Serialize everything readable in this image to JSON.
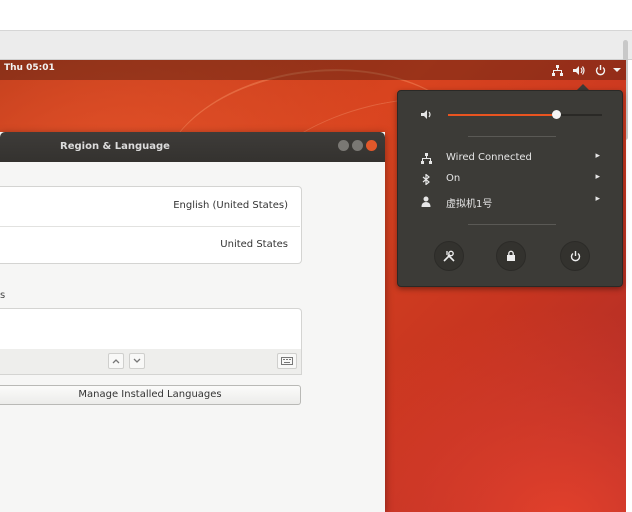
{
  "topbar": {
    "clock": "Thu 05:01"
  },
  "window": {
    "title": "Region & Language",
    "language_value": "English (United States)",
    "formats_value": "United States",
    "input_sources_label": "s",
    "manage_button": "Manage Installed Languages"
  },
  "system_menu": {
    "volume_percent": 70,
    "items": [
      {
        "label": "Wired Connected",
        "icon": "network-wired-icon"
      },
      {
        "label": "On",
        "icon": "bluetooth-icon"
      },
      {
        "label": "虚拟机1号",
        "icon": "user-icon"
      }
    ],
    "buttons": [
      "settings-icon",
      "lock-icon",
      "power-icon"
    ]
  },
  "colors": {
    "accent": "#e95420",
    "panel": "#3c3b37"
  }
}
